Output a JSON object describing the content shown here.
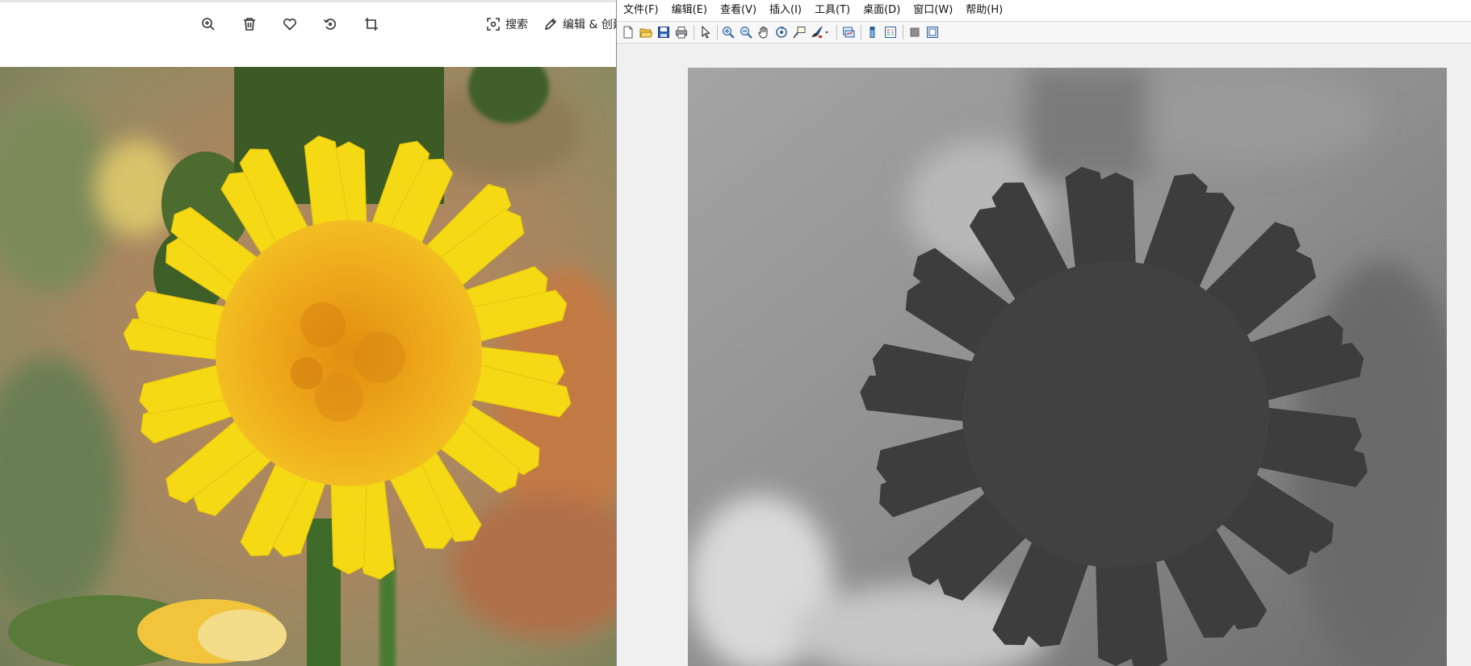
{
  "viewer": {
    "tools": [
      {
        "icon": "zoom-in-icon"
      },
      {
        "icon": "trash-icon"
      },
      {
        "icon": "heart-icon"
      },
      {
        "icon": "rotate-icon"
      },
      {
        "icon": "crop-icon"
      }
    ],
    "search_label": "搜索",
    "edit_label": "编辑 & 创建"
  },
  "figure_window": {
    "menu": [
      "文件(F)",
      "编辑(E)",
      "查看(V)",
      "插入(I)",
      "工具(T)",
      "桌面(D)",
      "窗口(W)",
      "帮助(H)"
    ],
    "toolbar_icons": [
      "new-figure-icon",
      "open-file-icon",
      "save-icon",
      "print-icon",
      "select-arrow-icon",
      "zoom-in-icon",
      "zoom-out-icon",
      "pan-hand-icon",
      "rotate-3d-icon",
      "data-cursor-icon",
      "brush-icon",
      "link-plot-icon",
      "colorbar-icon",
      "legend-icon",
      "hide-plot-tools-icon",
      "show-plot-tools-icon"
    ]
  }
}
